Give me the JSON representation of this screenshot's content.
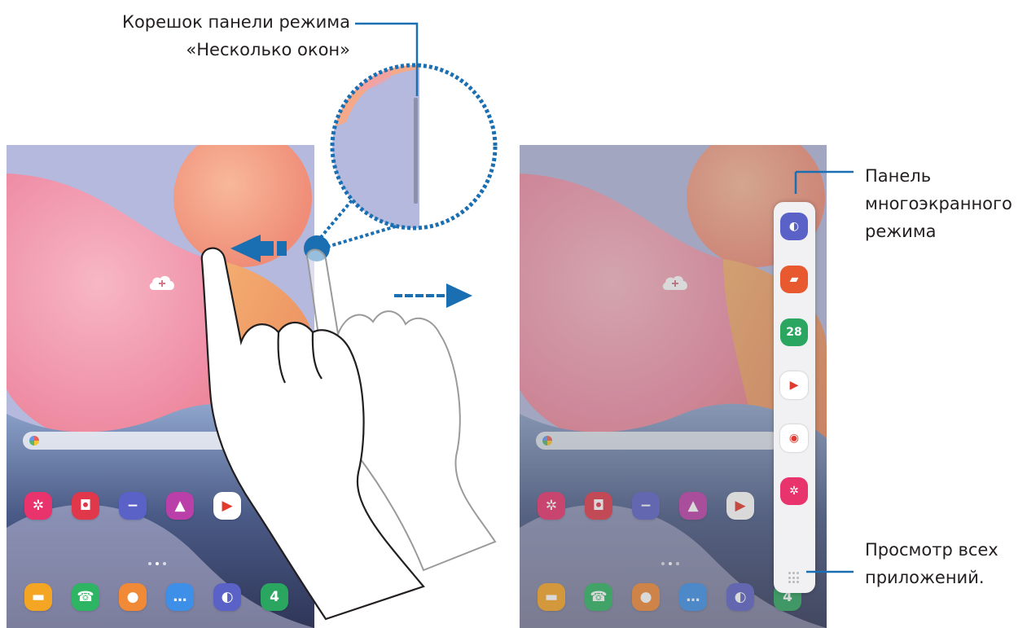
{
  "callouts": {
    "handle_line1": "Корешок панели режима",
    "handle_line2": "«Несколько окон»",
    "panel_line1": "Панель",
    "panel_line2": "многоэкранного",
    "panel_line3": "режима",
    "all_apps_line1": "Просмотр всех",
    "all_apps_line2": "приложений."
  },
  "home_screen": {
    "apps_row": [
      {
        "icon": "gallery-icon",
        "color": "#e8336c",
        "glyph": "✲"
      },
      {
        "icon": "camera-icon",
        "color": "#e0384a",
        "glyph": "◘"
      },
      {
        "icon": "minus-circle-icon",
        "color": "#5a62c7",
        "glyph": "−"
      },
      {
        "icon": "galaxy-store-icon",
        "color": "#bb3fa8",
        "glyph": "▲"
      },
      {
        "icon": "play-store-icon",
        "color": "#ffffff",
        "glyph": "▶"
      }
    ],
    "dock": [
      {
        "icon": "my-files-icon",
        "color": "#f5a524",
        "glyph": "▬"
      },
      {
        "icon": "phone-icon",
        "color": "#2db563",
        "glyph": "☎"
      },
      {
        "icon": "contacts-icon",
        "color": "#f08a37",
        "glyph": "●"
      },
      {
        "icon": "messages-icon",
        "color": "#3e8fe8",
        "glyph": "…"
      },
      {
        "icon": "internet-icon",
        "color": "#5a62c7",
        "glyph": "◐"
      },
      {
        "icon": "calendar-icon",
        "color": "#2aa660",
        "glyph": "4"
      }
    ]
  },
  "edge_panel": {
    "apps": [
      {
        "icon": "internet-icon",
        "color": "#5a62c7",
        "glyph": "◐"
      },
      {
        "icon": "notes-icon",
        "color": "#e8592f",
        "glyph": "▰"
      },
      {
        "icon": "calendar-icon",
        "color": "#2aa660",
        "glyph": "28"
      },
      {
        "icon": "youtube-icon",
        "color": "#ffffff",
        "glyph": "▶"
      },
      {
        "icon": "chrome-icon",
        "color": "#ffffff",
        "glyph": "◉"
      },
      {
        "icon": "gallery-icon",
        "color": "#e8336c",
        "glyph": "✲"
      }
    ],
    "all_apps_icon": "grid-icon"
  },
  "colors": {
    "accent_blue": "#1a6fb3",
    "wallpaper_pink": "#f0a3b3",
    "wallpaper_peach": "#f6a989",
    "wallpaper_lavender": "#b5b9dc"
  }
}
